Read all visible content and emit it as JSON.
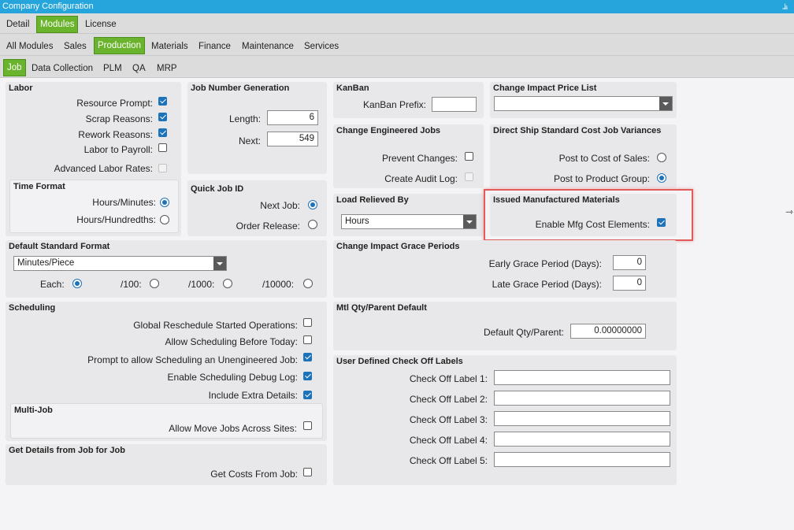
{
  "window": {
    "title": "Company Configuration",
    "pin_icon": "pin-icon"
  },
  "tabs_level1": [
    "Detail",
    "Modules",
    "License"
  ],
  "tabs_level2": [
    "All Modules",
    "Sales",
    "Production",
    "Materials",
    "Finance",
    "Maintenance",
    "Services"
  ],
  "tabs_level3": [
    "Job",
    "Data Collection",
    "PLM",
    "QA",
    "MRP"
  ],
  "labor": {
    "title": "Labor",
    "resource_prompt": "Resource Prompt:",
    "scrap_reasons": "Scrap Reasons:",
    "rework_reasons": "Rework Reasons:",
    "labor_to_payroll": "Labor to Payroll:",
    "advanced_labor_rates": "Advanced Labor Rates:"
  },
  "time_format": {
    "title": "Time Format",
    "hours_minutes": "Hours/Minutes:",
    "hours_hundredths": "Hours/Hundredths:"
  },
  "job_number": {
    "title": "Job Number Generation",
    "length_label": "Length:",
    "length_value": "6",
    "next_label": "Next:",
    "next_value": "549"
  },
  "quick_job": {
    "title": "Quick Job ID",
    "next_job": "Next Job:",
    "order_release": "Order Release:"
  },
  "kanban": {
    "title": "KanBan",
    "prefix_label": "KanBan Prefix:",
    "prefix_value": ""
  },
  "change_eng": {
    "title": "Change Engineered Jobs",
    "prevent_changes": "Prevent Changes:",
    "create_audit_log": "Create Audit Log:"
  },
  "load_relieved": {
    "title": "Load Relieved By",
    "value": "Hours"
  },
  "price_list": {
    "title": "Change Impact Price List",
    "value": ""
  },
  "direct_ship": {
    "title": "Direct Ship Standard Cost Job Variances",
    "post_cost_sales": "Post to Cost of Sales:",
    "post_product_group": "Post to Product Group:"
  },
  "issued_mfg": {
    "title": "Issued Manufactured Materials",
    "enable_label": "Enable Mfg Cost Elements:"
  },
  "std_format": {
    "title": "Default Standard Format",
    "value": "Minutes/Piece",
    "each": "Each:",
    "per100": "/100:",
    "per1000": "/1000:",
    "per10000": "/10000:"
  },
  "grace": {
    "title": "Change Impact Grace Periods",
    "early_label": "Early Grace Period (Days):",
    "early_value": "0",
    "late_label": "Late Grace Period (Days):",
    "late_value": "0"
  },
  "mtl_qty": {
    "title": "Mtl Qty/Parent Default",
    "label": "Default Qty/Parent:",
    "value": "0.00000000"
  },
  "scheduling": {
    "title": "Scheduling",
    "global_reschedule": "Global Reschedule Started Operations:",
    "allow_before_today": "Allow Scheduling Before Today:",
    "prompt_unengineered": "Prompt to allow Scheduling an Unengineered Job:",
    "debug_log": "Enable Scheduling Debug Log:",
    "extra_details": "Include Extra Details:"
  },
  "multi_job": {
    "title": "Multi-Job",
    "allow_move": "Allow Move Jobs Across Sites:"
  },
  "get_details": {
    "title": "Get Details from Job for Job",
    "get_costs": "Get Costs From Job:"
  },
  "check_off": {
    "title": "User Defined Check Off Labels",
    "labels": [
      "Check Off Label 1:",
      "Check Off Label 2:",
      "Check Off Label 3:",
      "Check Off Label 4:",
      "Check Off Label 5:"
    ]
  },
  "colors": {
    "accent_green": "#6ab42d",
    "title_blue": "#26a5dd",
    "check_blue": "#1d72b8",
    "highlight_red": "#e25a5a"
  }
}
